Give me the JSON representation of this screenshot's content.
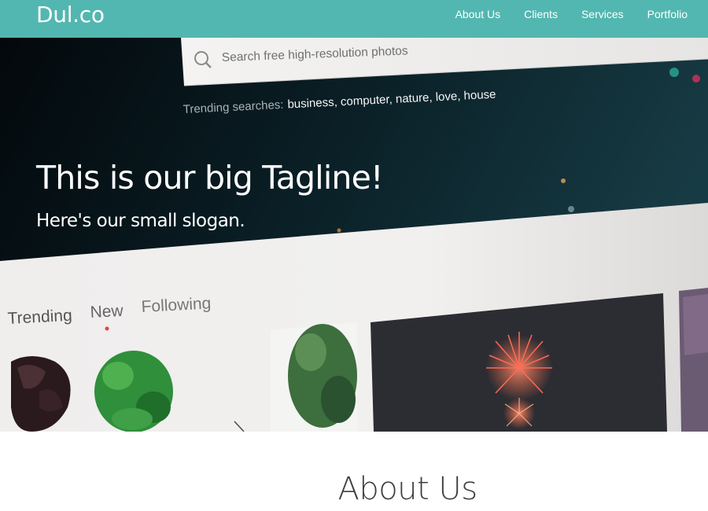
{
  "navbar": {
    "brand": "Dul.co",
    "links": [
      "About Us",
      "Clients",
      "Services",
      "Portfolio"
    ]
  },
  "hero": {
    "tagline": "This is our big Tagline!",
    "slogan": "Here's our small slogan.",
    "background_photo": {
      "search_placeholder": "Search free high-resolution photos",
      "trending_prefix": "Trending searches:",
      "trending_terms": [
        "business",
        "computer",
        "nature",
        "love",
        "house"
      ],
      "tabs": [
        "Trending",
        "New",
        "Following"
      ]
    }
  },
  "about": {
    "title": "About Us"
  },
  "colors": {
    "navbar": "#52b7b0",
    "hero_dark": "#0b1c22",
    "tab_dot": "#e0453a",
    "about_title": "#3f3f3f"
  }
}
